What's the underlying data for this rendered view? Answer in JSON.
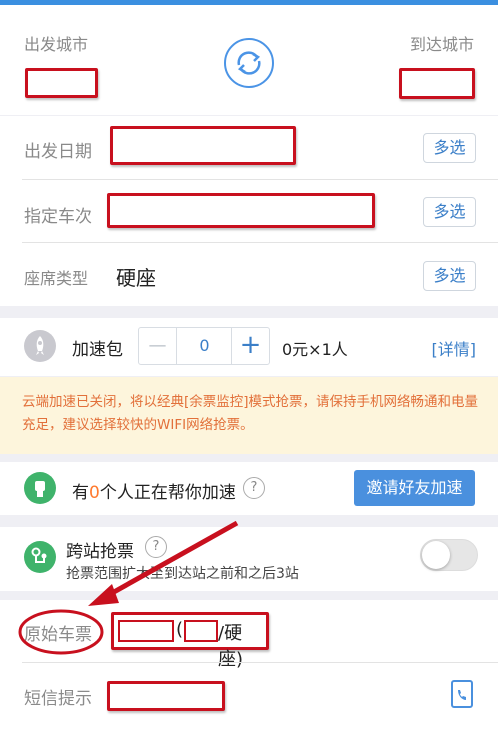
{
  "route": {
    "from_label": "出发城市",
    "to_label": "到达城市"
  },
  "form": {
    "date_label": "出发日期",
    "train_label": "指定车次",
    "seat_label": "座席类型",
    "seat_value": "硬座",
    "multi_select": "多选"
  },
  "speed": {
    "label": "加速包",
    "minus": "—",
    "count": "0",
    "plus": "+",
    "price": "0元×1人",
    "details": "[详情]"
  },
  "notice": {
    "text": "云端加速已关闭，将以经典[余票监控]模式抢票，请保持手机网络畅通和电量充足，建议选择较快的WIFI网络抢票。"
  },
  "helpers": {
    "prefix": "有",
    "count": "0",
    "suffix": "个人正在帮你加速",
    "help": "?",
    "invite_button": "邀请好友加速"
  },
  "cross_station": {
    "title": "跨站抢票",
    "help": "?",
    "desc": "抢票范围扩大至到达站之前和之后3站",
    "enabled": false
  },
  "original_ticket": {
    "label": "原始车票",
    "open_paren": "(",
    "suffix": "/硬座)"
  },
  "sms": {
    "label": "短信提示"
  },
  "colors": {
    "accent": "#3b8fe0",
    "annotation_red": "#c8101e",
    "notice_bg": "#fdf5dc",
    "notice_text": "#e2703a",
    "helper_count": "#ff7a2f"
  }
}
